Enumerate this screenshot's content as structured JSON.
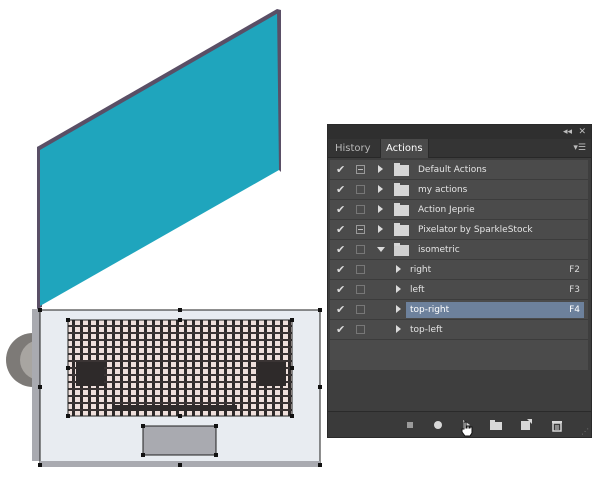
{
  "panel": {
    "tabs": [
      {
        "label": "History",
        "active": false
      },
      {
        "label": "Actions",
        "active": true
      }
    ],
    "collapse_icon": "double-chevron-left-icon",
    "close_icon": "close-icon",
    "menu_icon": "panel-menu-icon"
  },
  "actions": [
    {
      "label": "Default Actions",
      "type": "set",
      "checked": true,
      "dialog": true,
      "expanded": false,
      "fkey": ""
    },
    {
      "label": "my actions",
      "type": "set",
      "checked": true,
      "dialog": false,
      "expanded": false,
      "fkey": ""
    },
    {
      "label": "Action Jeprie",
      "type": "set",
      "checked": true,
      "dialog": false,
      "expanded": false,
      "fkey": ""
    },
    {
      "label": "Pixelator by SparkleStock",
      "type": "set",
      "checked": true,
      "dialog": true,
      "expanded": false,
      "fkey": ""
    },
    {
      "label": "isometric",
      "type": "set",
      "checked": true,
      "dialog": false,
      "expanded": true,
      "fkey": ""
    },
    {
      "label": "right",
      "type": "action",
      "checked": true,
      "dialog": false,
      "expanded": false,
      "fkey": "F2"
    },
    {
      "label": "left",
      "type": "action",
      "checked": true,
      "dialog": false,
      "expanded": false,
      "fkey": "F3"
    },
    {
      "label": "top-right",
      "type": "action",
      "checked": true,
      "dialog": false,
      "expanded": false,
      "fkey": "F4",
      "selected": true
    },
    {
      "label": "top-left",
      "type": "action",
      "checked": true,
      "dialog": false,
      "expanded": false,
      "fkey": ""
    }
  ],
  "check_glyph": "✔",
  "bottom_bar": [
    "stop-icon",
    "record-icon",
    "play-icon",
    "new-set-folder-icon",
    "new-action-icon",
    "trash-icon"
  ],
  "colors": {
    "selected": "#6d819c",
    "screen_cyan": "#1fa5bd",
    "screen_edge": "#5a4f66"
  }
}
